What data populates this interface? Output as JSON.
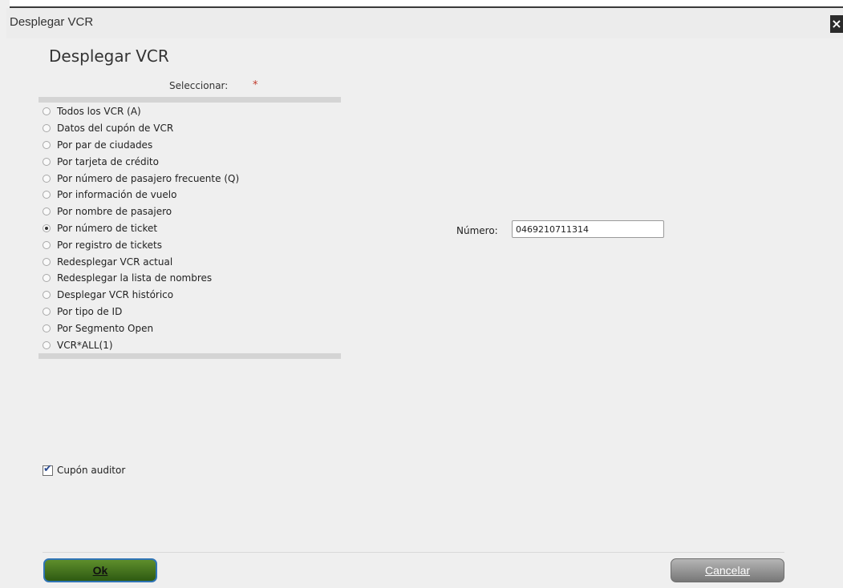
{
  "window": {
    "title": "Desplegar VCR",
    "close_glyph": "×"
  },
  "form": {
    "heading": "Desplegar VCR",
    "select_label": "Seleccionar:",
    "required_marker": "*",
    "selected_index": 7,
    "options": [
      {
        "label": "Todos los VCR (A)"
      },
      {
        "label": "Datos del cupón de VCR"
      },
      {
        "label": "Por par de ciudades"
      },
      {
        "label": "Por tarjeta de crédito"
      },
      {
        "label": "Por número de pasajero frecuente (Q)"
      },
      {
        "label": "Por información de vuelo"
      },
      {
        "label": "Por nombre de pasajero"
      },
      {
        "label": "Por número de ticket"
      },
      {
        "label": "Por registro de tickets"
      },
      {
        "label": "Redesplegar VCR actual"
      },
      {
        "label": "Redesplegar la lista de nombres"
      },
      {
        "label": "Desplegar VCR histórico"
      },
      {
        "label": "Por tipo de ID"
      },
      {
        "label": "Por Segmento Open"
      },
      {
        "label": "VCR*ALL(1)"
      }
    ],
    "numero_label": "Número:",
    "numero_value": "0469210711314",
    "auditor_checkbox": {
      "label": "Cupón auditor",
      "checked": true
    }
  },
  "buttons": {
    "ok_label": "Ok",
    "cancel_label": "Cancelar"
  },
  "colors": {
    "ok_button": "#3d6e1e",
    "cancel_button": "#8f8f8f",
    "required_marker": "#c0392b"
  }
}
